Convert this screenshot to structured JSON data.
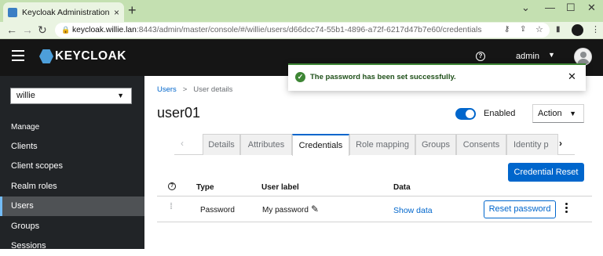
{
  "browser": {
    "tab_title": "Keycloak Administration Console",
    "tab_close": "×",
    "new_tab": "+",
    "url_host": "keycloak.willie.lan",
    "url_rest": ":8443/admin/master/console/#/willie/users/d66dcc74-55b1-4896-a72f-6217d47b7e60/credentials"
  },
  "masthead": {
    "logo_text": "KEYCLOAK",
    "user": "admin"
  },
  "sidebar": {
    "realm": "willie",
    "section": "Manage",
    "items": [
      {
        "label": "Clients"
      },
      {
        "label": "Client scopes"
      },
      {
        "label": "Realm roles"
      },
      {
        "label": "Users"
      },
      {
        "label": "Groups"
      },
      {
        "label": "Sessions"
      }
    ],
    "active_item": "Users"
  },
  "breadcrumb": {
    "link": "Users",
    "separator": ">",
    "current": "User details"
  },
  "page": {
    "title": "user01",
    "enabled_label": "Enabled",
    "enabled": true,
    "action_label": "Action"
  },
  "tabs": [
    {
      "label": "Details"
    },
    {
      "label": "Attributes"
    },
    {
      "label": "Credentials"
    },
    {
      "label": "Role mapping"
    },
    {
      "label": "Groups"
    },
    {
      "label": "Consents"
    },
    {
      "label": "Identity p"
    }
  ],
  "active_tab": "Credentials",
  "credentials": {
    "reset_button": "Credential Reset",
    "columns": [
      "Type",
      "User label",
      "Data"
    ],
    "rows": [
      {
        "type": "Password",
        "user_label": "My password",
        "data": "Show data",
        "action": "Reset password"
      }
    ]
  },
  "toast": {
    "message": "The password has been set successfully.",
    "variant": "success"
  },
  "colors": {
    "accent": "#0066cc",
    "success": "#3e8635",
    "masthead": "#151515",
    "sidebar": "#212427"
  }
}
